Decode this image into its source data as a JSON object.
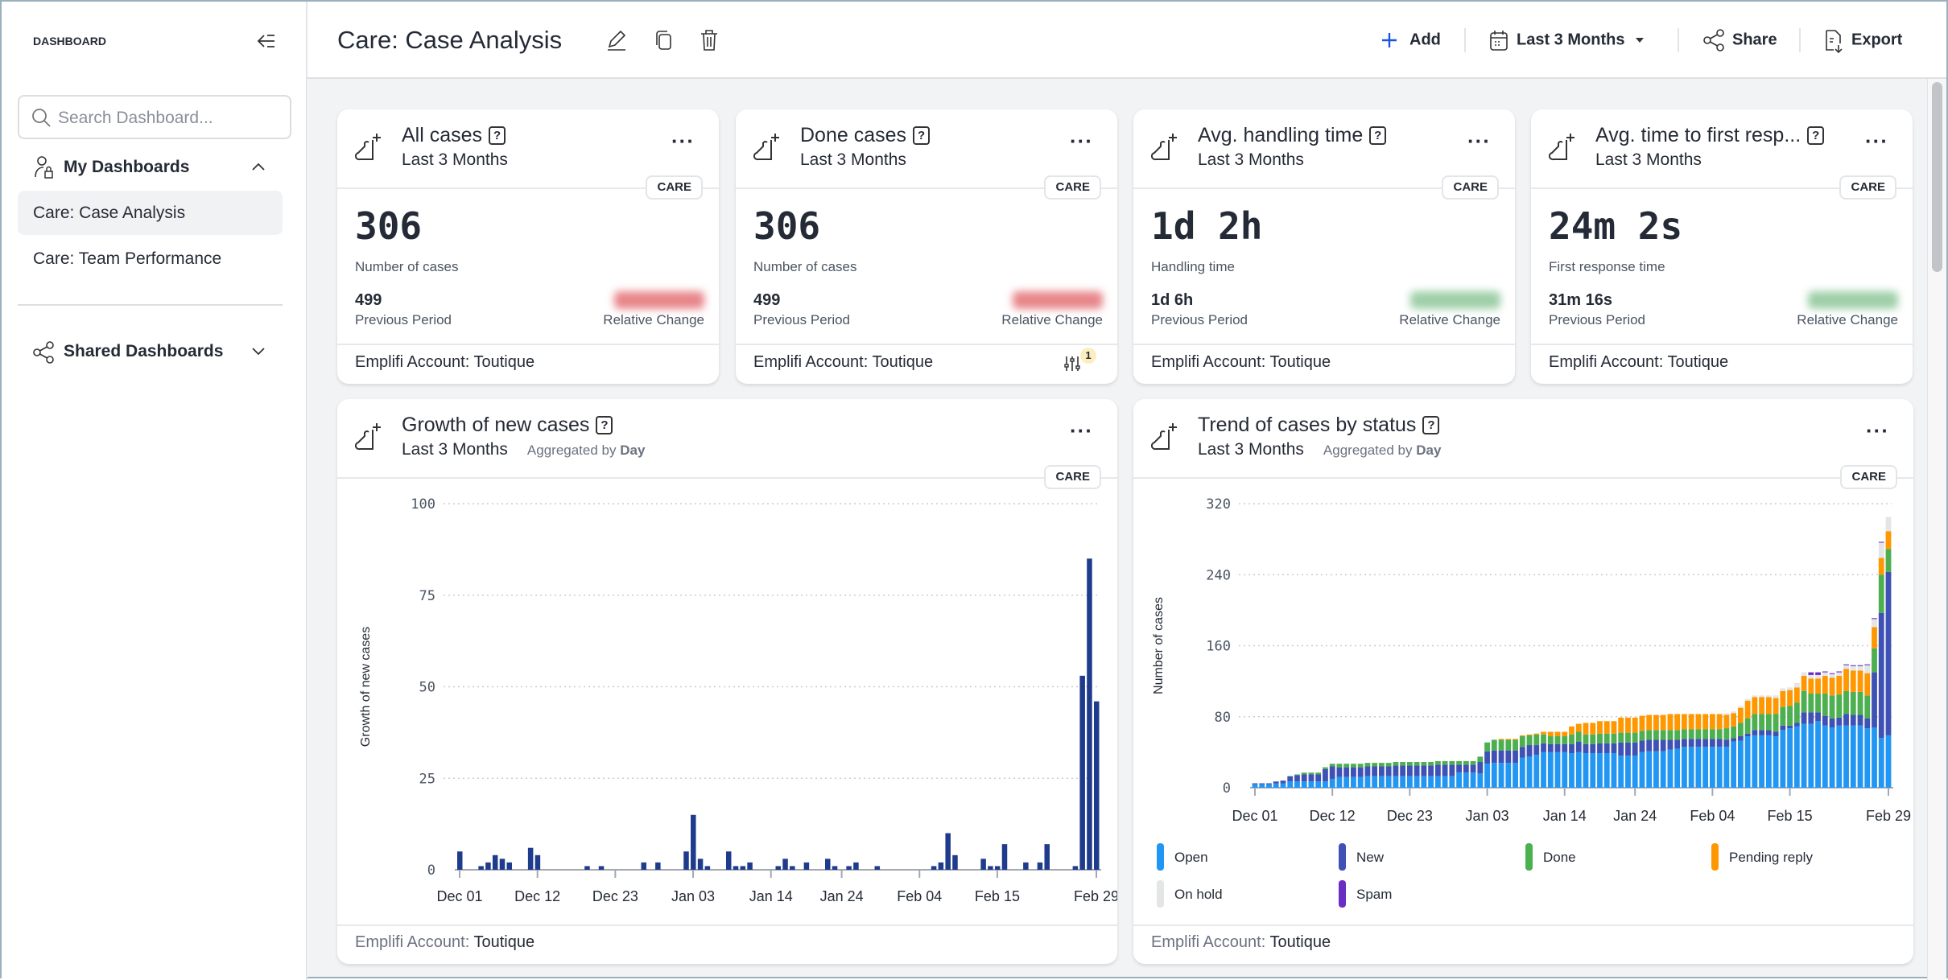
{
  "sidebar": {
    "title": "DASHBOARD",
    "search_placeholder": "Search Dashboard...",
    "my_dashboards": {
      "label": "My Dashboards",
      "items": [
        {
          "label": "Care: Case Analysis",
          "active": true
        },
        {
          "label": "Care: Team Performance",
          "active": false
        }
      ]
    },
    "shared_dashboards": {
      "label": "Shared Dashboards"
    }
  },
  "header": {
    "title": "Care: Case Analysis",
    "add_label": "Add",
    "date_range": "Last 3 Months",
    "share_label": "Share",
    "export_label": "Export",
    "accent": "#1a56db"
  },
  "kpis": [
    {
      "title": "All cases",
      "period": "Last 3 Months",
      "badge": "CARE",
      "value": "306",
      "value_label": "Number of cases",
      "prev_value": "499",
      "prev_label": "Previous Period",
      "change_label": "Relative Change",
      "change_color": "#e8868a",
      "footer_label": "Emplifi Account:",
      "footer_value": "Toutique"
    },
    {
      "title": "Done cases",
      "period": "Last 3 Months",
      "badge": "CARE",
      "value": "306",
      "value_label": "Number of cases",
      "prev_value": "499",
      "prev_label": "Previous Period",
      "change_label": "Relative Change",
      "change_color": "#e8868a",
      "footer_label": "Emplifi Account:",
      "footer_value": "Toutique",
      "filter_count": "1"
    },
    {
      "title": "Avg. handling time",
      "period": "Last 3 Months",
      "badge": "CARE",
      "value": "1d 2h",
      "value_label": "Handling time",
      "prev_value": "1d 6h",
      "prev_label": "Previous Period",
      "change_label": "Relative Change",
      "change_color": "#9fcfa8",
      "footer_label": "Emplifi Account:",
      "footer_value": "Toutique"
    },
    {
      "title": "Avg. time to first resp...",
      "period": "Last 3 Months",
      "badge": "CARE",
      "value": "24m 2s",
      "value_label": "First response time",
      "prev_value": "31m 16s",
      "prev_label": "Previous Period",
      "change_label": "Relative Change",
      "change_color": "#9fcfa8",
      "footer_label": "Emplifi Account:",
      "footer_value": "Toutique"
    }
  ],
  "charts": [
    {
      "title": "Growth of new cases",
      "period": "Last 3 Months",
      "agg_label": "Aggregated by",
      "agg_value": "Day",
      "badge": "CARE",
      "footer_label": "Emplifi Account:",
      "footer_value": "Toutique"
    },
    {
      "title": "Trend of cases by status",
      "period": "Last 3 Months",
      "agg_label": "Aggregated by",
      "agg_value": "Day",
      "badge": "CARE",
      "footer_label": "Emplifi Account:",
      "footer_value": "Toutique"
    }
  ],
  "dates": [
    "Dec 01",
    "Dec 02",
    "Dec 03",
    "Dec 04",
    "Dec 05",
    "Dec 06",
    "Dec 07",
    "Dec 08",
    "Dec 09",
    "Dec 10",
    "Dec 11",
    "Dec 12",
    "Dec 13",
    "Dec 14",
    "Dec 15",
    "Dec 16",
    "Dec 17",
    "Dec 18",
    "Dec 19",
    "Dec 20",
    "Dec 21",
    "Dec 22",
    "Dec 23",
    "Dec 24",
    "Dec 25",
    "Dec 26",
    "Dec 27",
    "Dec 28",
    "Dec 29",
    "Dec 30",
    "Dec 31",
    "Jan 01",
    "Jan 02",
    "Jan 03",
    "Jan 04",
    "Jan 05",
    "Jan 06",
    "Jan 07",
    "Jan 08",
    "Jan 09",
    "Jan 10",
    "Jan 11",
    "Jan 12",
    "Jan 13",
    "Jan 14",
    "Jan 15",
    "Jan 16",
    "Jan 17",
    "Jan 18",
    "Jan 19",
    "Jan 20",
    "Jan 21",
    "Jan 22",
    "Jan 23",
    "Jan 24",
    "Jan 25",
    "Jan 26",
    "Jan 27",
    "Jan 28",
    "Jan 29",
    "Jan 30",
    "Jan 31",
    "Feb 01",
    "Feb 02",
    "Feb 03",
    "Feb 04",
    "Feb 05",
    "Feb 06",
    "Feb 07",
    "Feb 08",
    "Feb 09",
    "Feb 10",
    "Feb 11",
    "Feb 12",
    "Feb 13",
    "Feb 14",
    "Feb 15",
    "Feb 16",
    "Feb 17",
    "Feb 18",
    "Feb 19",
    "Feb 20",
    "Feb 21",
    "Feb 22",
    "Feb 23",
    "Feb 24",
    "Feb 25",
    "Feb 26",
    "Feb 27",
    "Feb 28",
    "Feb 29"
  ],
  "chart_data": [
    {
      "type": "bar",
      "ylabel": "Growth of new cases",
      "ylim": [
        0,
        100
      ],
      "y_ticks": [
        "0",
        "25",
        "50",
        "75",
        "100"
      ],
      "x_ticks": [
        "Dec 01",
        "Dec 12",
        "Dec 23",
        "Jan 03",
        "Jan 14",
        "Jan 24",
        "Feb 04",
        "Feb 15",
        "Feb 29"
      ],
      "grid": true,
      "color": "#1f3b8c",
      "values": [
        5,
        0,
        0,
        1,
        2,
        4,
        3,
        2,
        0,
        0,
        6,
        4,
        0,
        0,
        0,
        0,
        0,
        0,
        1,
        0,
        1,
        0,
        0,
        0,
        0,
        0,
        2,
        0,
        2,
        0,
        0,
        0,
        5,
        15,
        3,
        1,
        0,
        0,
        5,
        1,
        1,
        2,
        0,
        0,
        0,
        1,
        3,
        1,
        0,
        2,
        0,
        0,
        3,
        1,
        0,
        1,
        2,
        0,
        0,
        1,
        0,
        0,
        0,
        0,
        0,
        0,
        0,
        1,
        2,
        10,
        4,
        0,
        0,
        0,
        3,
        1,
        1,
        7,
        0,
        0,
        2,
        0,
        2,
        7,
        0,
        0,
        0,
        1,
        53,
        85,
        46
      ]
    },
    {
      "type": "bar",
      "stacked": true,
      "ylabel": "Number of cases",
      "ylim": [
        0,
        320
      ],
      "y_ticks": [
        "0",
        "80",
        "160",
        "240",
        "320"
      ],
      "x_ticks": [
        "Dec 01",
        "Dec 12",
        "Dec 23",
        "Jan 03",
        "Jan 14",
        "Jan 24",
        "Feb 04",
        "Feb 15",
        "Feb 29"
      ],
      "grid": true,
      "legend": "bottom",
      "series": [
        {
          "name": "Open",
          "color": "#2196f3",
          "values": [
            4,
            4,
            4,
            5,
            5,
            7,
            7,
            7,
            7,
            7,
            7,
            10,
            12,
            12,
            12,
            12,
            13,
            13,
            13,
            13,
            13,
            13,
            13,
            13,
            13,
            13,
            13,
            13,
            13,
            17,
            17,
            17,
            16,
            27,
            28,
            28,
            28,
            28,
            34,
            35,
            37,
            40,
            40,
            40,
            40,
            39,
            40,
            39,
            39,
            39,
            39,
            39,
            36,
            36,
            36,
            40,
            41,
            41,
            41,
            43,
            44,
            46,
            46,
            46,
            46,
            46,
            46,
            46,
            52,
            53,
            58,
            59,
            59,
            59,
            58,
            65,
            67,
            69,
            72,
            72,
            75,
            70,
            68,
            70,
            70,
            70,
            70,
            67,
            68,
            56,
            59
          ]
        },
        {
          "name": "New",
          "color": "#3f51b5",
          "values": [
            1,
            1,
            1,
            2,
            3,
            6,
            7,
            8,
            8,
            8,
            14,
            14,
            11,
            11,
            11,
            11,
            11,
            11,
            11,
            11,
            12,
            12,
            12,
            12,
            12,
            12,
            13,
            13,
            13,
            9,
            9,
            9,
            13,
            14,
            14,
            14,
            14,
            14,
            12,
            13,
            11,
            10,
            9,
            9,
            9,
            10,
            12,
            10,
            10,
            11,
            11,
            11,
            15,
            15,
            15,
            13,
            13,
            13,
            13,
            11,
            10,
            9,
            9,
            9,
            9,
            9,
            9,
            8,
            4,
            5,
            3,
            6,
            6,
            6,
            5,
            5,
            3,
            4,
            13,
            13,
            10,
            11,
            10,
            9,
            13,
            12,
            12,
            11,
            62,
            141,
            184
          ]
        },
        {
          "name": "Done",
          "color": "#4caf50",
          "values": [
            0,
            0,
            0,
            0,
            0,
            0,
            1,
            2,
            2,
            2,
            2,
            3,
            4,
            4,
            4,
            4,
            4,
            4,
            4,
            4,
            4,
            4,
            4,
            4,
            4,
            4,
            4,
            4,
            4,
            4,
            4,
            4,
            6,
            10,
            12,
            12,
            12,
            12,
            12,
            11,
            12,
            10,
            9,
            9,
            9,
            11,
            11,
            11,
            11,
            11,
            11,
            11,
            11,
            11,
            11,
            11,
            11,
            11,
            11,
            11,
            11,
            11,
            11,
            11,
            11,
            11,
            11,
            13,
            13,
            15,
            17,
            18,
            18,
            18,
            20,
            21,
            22,
            23,
            24,
            21,
            21,
            25,
            26,
            26,
            26,
            26,
            26,
            26,
            27,
            43,
            26
          ]
        },
        {
          "name": "Pending reply",
          "color": "#ff9800",
          "values": [
            0,
            0,
            0,
            0,
            0,
            0,
            0,
            0,
            0,
            0,
            0,
            0,
            0,
            0,
            0,
            0,
            0,
            0,
            0,
            0,
            0,
            0,
            0,
            0,
            0,
            0,
            0,
            0,
            0,
            0,
            0,
            0,
            0,
            0,
            0,
            1,
            1,
            1,
            1,
            1,
            1,
            3,
            5,
            5,
            5,
            9,
            9,
            13,
            13,
            14,
            14,
            14,
            17,
            17,
            17,
            17,
            17,
            17,
            17,
            18,
            18,
            17,
            17,
            17,
            17,
            17,
            17,
            15,
            15,
            17,
            20,
            19,
            19,
            19,
            18,
            18,
            18,
            17,
            17,
            17,
            17,
            20,
            20,
            21,
            25,
            24,
            24,
            25,
            24,
            19,
            20
          ]
        },
        {
          "name": "On hold",
          "color": "#e4e5e7",
          "values": [
            0,
            0,
            0,
            0,
            0,
            0,
            0,
            0,
            0,
            0,
            0,
            0,
            0,
            0,
            0,
            0,
            0,
            0,
            0,
            0,
            0,
            0,
            0,
            0,
            0,
            0,
            0,
            0,
            0,
            0,
            0,
            0,
            0,
            0,
            0,
            0,
            0,
            0,
            0,
            0,
            0,
            0,
            0,
            0,
            0,
            0,
            0,
            0,
            0,
            0,
            0,
            0,
            0,
            0,
            0,
            0,
            0,
            0,
            0,
            0,
            0,
            0,
            0,
            0,
            0,
            0,
            0,
            2,
            2,
            2,
            2,
            2,
            2,
            2,
            3,
            3,
            3,
            5,
            4,
            4,
            4,
            4,
            4,
            4,
            4,
            5,
            5,
            9,
            9,
            17,
            16
          ]
        },
        {
          "name": "Spam",
          "color": "#6a2fc0",
          "values": [
            0,
            0,
            0,
            0,
            0,
            0,
            0,
            0,
            0,
            0,
            0,
            0,
            0,
            0,
            0,
            0,
            0,
            0,
            0,
            0,
            0,
            0,
            0,
            0,
            0,
            0,
            0,
            0,
            0,
            0,
            0,
            0,
            0,
            0,
            0,
            0,
            0,
            0,
            0,
            0,
            0,
            0,
            0,
            0,
            0,
            0,
            0,
            0,
            0,
            0,
            0,
            0,
            0,
            0,
            0,
            0,
            0,
            0,
            0,
            0,
            0,
            0,
            0,
            0,
            0,
            0,
            0,
            0,
            0,
            0,
            0,
            0,
            0,
            0,
            0,
            0,
            0,
            0,
            0,
            3,
            3,
            1,
            1,
            1,
            1,
            1,
            1,
            1,
            1,
            1,
            0
          ]
        }
      ]
    }
  ]
}
